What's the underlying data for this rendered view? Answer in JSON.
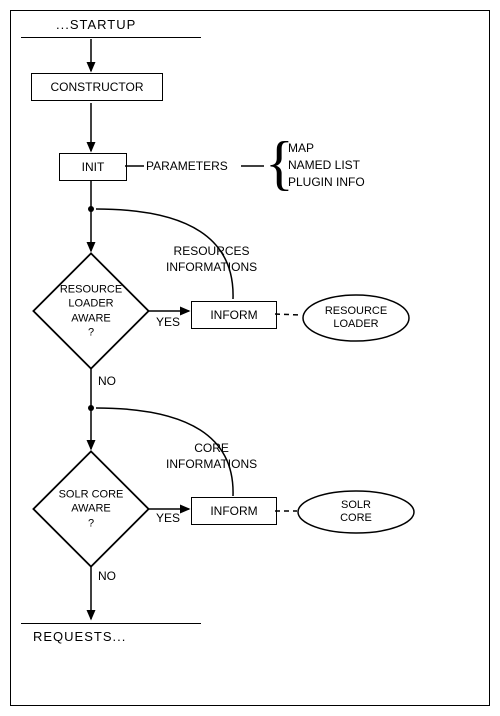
{
  "title": "...STARTUP",
  "nodes": {
    "constructor": "CONSTRUCTOR",
    "init": "INIT",
    "parameters_label": "PARAMETERS",
    "param_items": [
      "MAP",
      "NAMED LIST",
      "PLUGIN INFO"
    ],
    "resource_aware": "RESOURCE\nLOADER\nAWARE\n?",
    "inform1": "INFORM",
    "resources_info_label": "RESOURCES\nINFORMATIONS",
    "resource_loader": "RESOURCE\nLOADER",
    "solr_core_aware": "SOLR CORE\nAWARE\n?",
    "inform2": "INFORM",
    "core_info_label": "CORE\nINFORMATIONS",
    "solr_core": "SOLR CORE",
    "yes": "YES",
    "no": "NO"
  },
  "footer": "REQUESTS..."
}
